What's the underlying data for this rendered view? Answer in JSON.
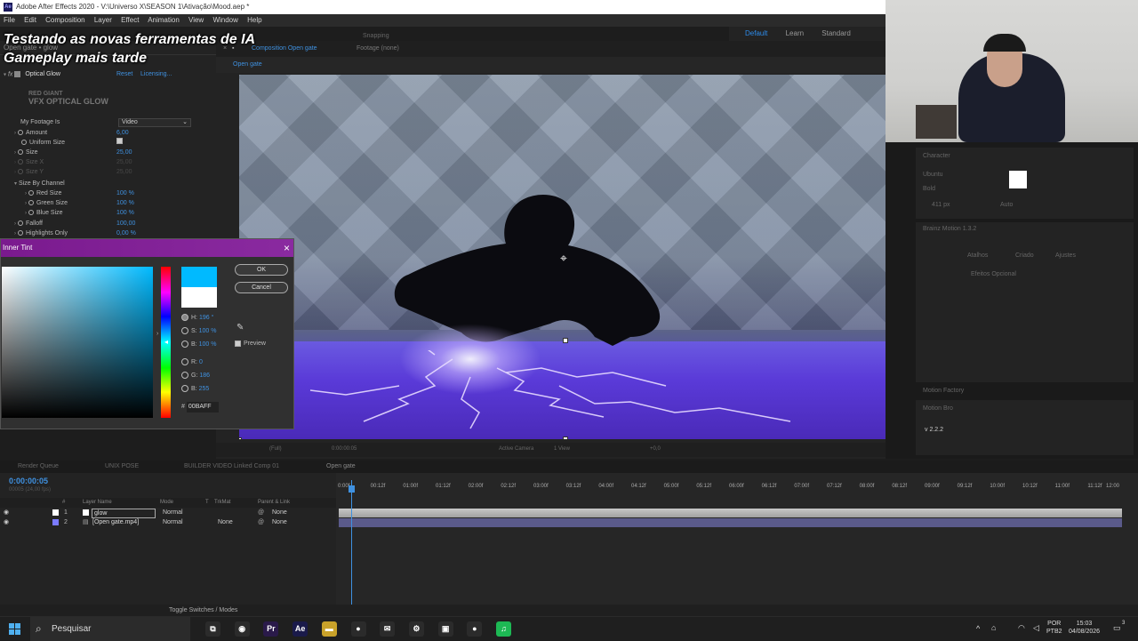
{
  "window": {
    "title": "Adobe After Effects 2020 - V:\\Universo X\\SEASON 1\\Ativação\\Mood.aep *",
    "app_icon": "Ae"
  },
  "menu": [
    "File",
    "Edit",
    "Composition",
    "Layer",
    "Effect",
    "Animation",
    "View",
    "Window",
    "Help"
  ],
  "workspaces": [
    "Default",
    "Learn",
    "Standard"
  ],
  "overlay": {
    "line1": "Testando as novas ferramentas de IA",
    "line2": "Gameplay mais tarde"
  },
  "effects": {
    "header": "Open gate • glow",
    "effect_name": "Optical Glow",
    "reset": "Reset",
    "licensing": "Licensing...",
    "logo_line1": "RED GIANT",
    "logo_line2": "VFX OPTICAL GLOW",
    "footage_label": "My Footage Is",
    "footage_value": "Video",
    "params": [
      {
        "name": "Amount",
        "value": "6,00"
      },
      {
        "name": "Uniform Size",
        "value": ""
      },
      {
        "name": "Size",
        "value": "25,00"
      },
      {
        "name": "Size X",
        "value": "25,00"
      },
      {
        "name": "Size Y",
        "value": "25,00"
      },
      {
        "name": "Size By Channel",
        "value": ""
      },
      {
        "name": "Red Size",
        "value": "100 %"
      },
      {
        "name": "Green Size",
        "value": "100 %"
      },
      {
        "name": "Blue Size",
        "value": "100 %"
      },
      {
        "name": "Falloff",
        "value": "100,00"
      },
      {
        "name": "Highlights Only",
        "value": "0,00 %"
      }
    ]
  },
  "color_picker": {
    "title": "Inner Tint",
    "ok": "OK",
    "cancel": "Cancel",
    "preview": "Preview",
    "h_label": "H:",
    "h_value": "196 °",
    "s_label": "S:",
    "s_value": "100 %",
    "b_label": "B:",
    "b_value": "100 %",
    "r_label": "R:",
    "r_value": "0",
    "g_label": "G:",
    "g_value": "186",
    "blue_label": "B:",
    "blue_value": "255",
    "hex_label": "#",
    "hex_value": "00BAFF",
    "new_color": "#00baff",
    "old_color": "#ffffff"
  },
  "composition": {
    "tabs": [
      "Composition Open gate",
      "Footage (none)"
    ],
    "snapping": "Snapping",
    "sub_tab": "Open gate",
    "viewer_toolbar": [
      "(Full)",
      "0:00:00:05",
      "Active Camera",
      "1 View",
      "+0,0"
    ]
  },
  "right_panels": {
    "character": "Character",
    "font": "Ubuntu",
    "style": "Bold",
    "size": "411 px",
    "leading": "Auto",
    "boris": "Brainz Motion 1.3.2",
    "tabs": [
      "Atalhos",
      "Criado",
      "Ajustes"
    ],
    "efeitos": "Efeitos Opcional",
    "motion_factory": "Motion Factory",
    "motion_bro": "Motion Bro",
    "version": "v 2.2.2"
  },
  "timeline": {
    "tabs": [
      "Render Queue",
      "UNIX POSE",
      "BUILDER VIDEO Linked Comp 01",
      "Open gate"
    ],
    "timecode": "0:00:00:05",
    "fps": "00005 (24,00 fps)",
    "headers": [
      "#",
      "Layer Name",
      "Mode",
      "T",
      "TrkMat",
      "Parent & Link"
    ],
    "layers": [
      {
        "num": "1",
        "name": "glow",
        "mode": "Normal",
        "trkmat": "",
        "parent": "None",
        "color": "#ffffff"
      },
      {
        "num": "2",
        "name": "[Open gate.mp4]",
        "mode": "Normal",
        "trkmat": "None",
        "parent": "None",
        "color": "#7a7aff"
      }
    ],
    "ruler": [
      "0:00f",
      "00:12f",
      "01:00f",
      "01:12f",
      "02:00f",
      "02:12f",
      "03:00f",
      "03:12f",
      "04:00f",
      "04:12f",
      "05:00f",
      "05:12f",
      "06:00f",
      "06:12f",
      "07:00f",
      "07:12f",
      "08:00f",
      "08:12f",
      "09:00f",
      "09:12f",
      "10:00f",
      "10:12f",
      "11:00f",
      "11:12f",
      "12:00"
    ],
    "footer": "Toggle Switches / Modes"
  },
  "taskbar": {
    "search": "Pesquisar",
    "apps": [
      {
        "name": "task-view",
        "label": "⧉",
        "color": "#2b2b2b"
      },
      {
        "name": "obs",
        "label": "◉",
        "color": "#2b2b2b"
      },
      {
        "name": "premiere",
        "label": "Pr",
        "color": "#2a1a4a"
      },
      {
        "name": "after-effects",
        "label": "Ae",
        "color": "#1a1a4a"
      },
      {
        "name": "explorer",
        "label": "▬",
        "color": "#c9a22a"
      },
      {
        "name": "chrome",
        "label": "●",
        "color": "#2b2b2b"
      },
      {
        "name": "mail",
        "label": "✉",
        "color": "#2b2b2b"
      },
      {
        "name": "settings",
        "label": "⚙",
        "color": "#2b2b2b"
      },
      {
        "name": "davinci",
        "label": "▣",
        "color": "#2b2b2b"
      },
      {
        "name": "chrome2",
        "label": "●",
        "color": "#2b2b2b"
      },
      {
        "name": "spotify",
        "label": "♫",
        "color": "#1db954"
      }
    ],
    "lang1": "POR",
    "lang2": "PTB2",
    "time": "15:03",
    "date": "04/08/2026",
    "notifications": "3"
  }
}
